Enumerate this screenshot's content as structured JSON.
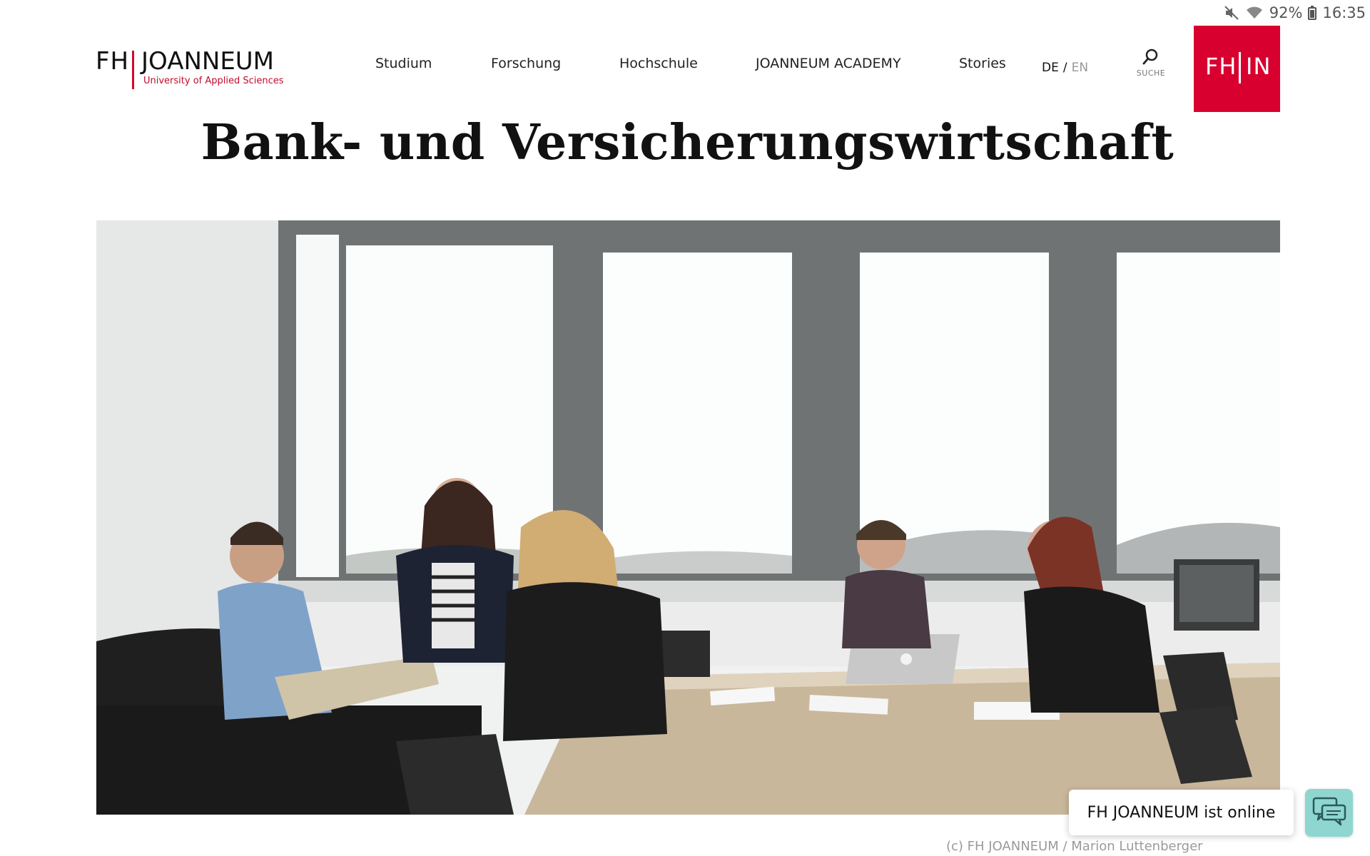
{
  "status_bar": {
    "battery": "92%",
    "time": "16:35",
    "icons": [
      "mute-icon",
      "wifi-icon",
      "battery-icon"
    ]
  },
  "header": {
    "logo": {
      "fh": "FH",
      "name": "JOANNEUM",
      "subtitle": "University of Applied Sciences"
    },
    "nav": [
      {
        "label": "Studium"
      },
      {
        "label": "Forschung"
      },
      {
        "label": "Hochschule"
      },
      {
        "label": "JOANNEUM ACADEMY"
      },
      {
        "label": "Stories"
      }
    ],
    "lang": {
      "active": "DE",
      "separator": "/",
      "other": "EN"
    },
    "search_label": "SUCHE",
    "fhin": {
      "left": "FH",
      "right": "IN"
    }
  },
  "page": {
    "title": "Bank- und Versicherungswirtschaft",
    "image_credit": "(c) FH JOANNEUM / Marion Luttenberger"
  },
  "chat": {
    "label": "FH JOANNEUM ist online"
  },
  "colors": {
    "brand_red": "#d8002f",
    "chat_teal": "#8fd6d0"
  }
}
